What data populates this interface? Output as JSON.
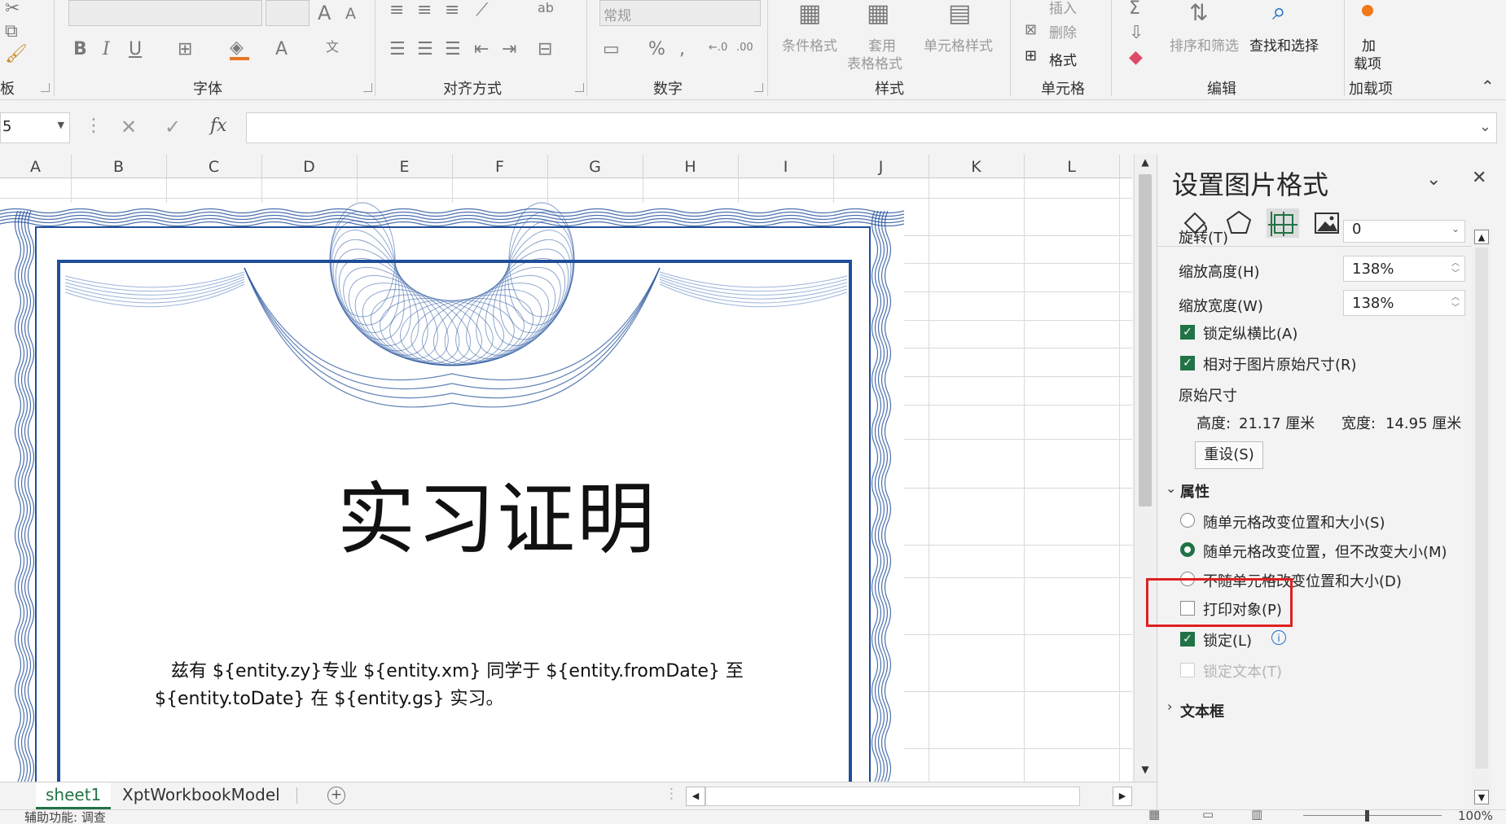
{
  "ribbon": {
    "clipboard_label": "板",
    "font_group": "字体",
    "align_group": "对齐方式",
    "number_group": "数字",
    "number_format": "常规",
    "styles_group": "样式",
    "cond_format": "条件格式",
    "table_format_1": "套用",
    "table_format_2": "表格格式",
    "cell_style": "单元格样式",
    "cells_group": "单元格",
    "insert": "插入",
    "delete": "删除",
    "format": "格式",
    "edit_group": "编辑",
    "sort_filter": "排序和筛选",
    "find_select": "查找和选择",
    "addins_1": "加",
    "addins_2": "载项",
    "addins_group": "加载项",
    "bold": "B",
    "italic": "I",
    "underline": "U",
    "percent": "%"
  },
  "formula_bar": {
    "name_box": "5",
    "fx": "fx",
    "formula": ""
  },
  "columns": [
    "A",
    "B",
    "C",
    "D",
    "E",
    "F",
    "G",
    "H",
    "I",
    "J",
    "K",
    "L"
  ],
  "certificate": {
    "title": "实习证明",
    "body_line1": "兹有 ${entity.zy}专业 ${entity.xm} 同学于 ${entity.fromDate} 至",
    "body_line2": "${entity.toDate} 在 ${entity.gs} 实习。"
  },
  "tabs": {
    "sheet1": "sheet1",
    "sheet2": "XptWorkbookModel"
  },
  "status": {
    "text": "辅助功能: 调查",
    "zoom": "100%"
  },
  "pane": {
    "title": "设置图片格式",
    "rotation_label": "旋转(T)",
    "rotation_value": "0",
    "scale_h_label": "缩放高度(H)",
    "scale_h_value": "138%",
    "scale_w_label": "缩放宽度(W)",
    "scale_w_value": "138%",
    "lock_aspect": "锁定纵横比(A)",
    "relative_orig": "相对于图片原始尺寸(R)",
    "orig_size": "原始尺寸",
    "height_label": "高度:",
    "height_value": "21.17 厘米",
    "width_label": "宽度:",
    "width_value": "14.95 厘米",
    "reset": "重设(S)",
    "props_section": "属性",
    "radio1": "随单元格改变位置和大小(S)",
    "radio2": "随单元格改变位置，但不改变大小(M)",
    "radio3": "不随单元格改变位置和大小(D)",
    "print_obj": "打印对象(P)",
    "locked": "锁定(L)",
    "lock_text": "锁定文本(T)",
    "textbox_section": "文本框"
  },
  "colors": {
    "accent": "#217346",
    "highlight": "#e02020",
    "border_blue": "#1f4e9a"
  }
}
